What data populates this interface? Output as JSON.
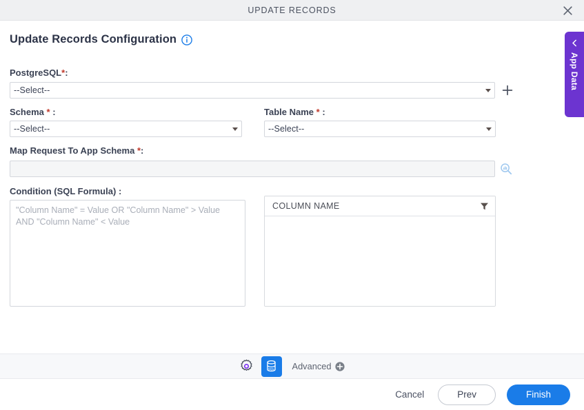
{
  "window": {
    "title": "UPDATE RECORDS",
    "close_icon": "close-icon"
  },
  "page": {
    "heading": "Update Records Configuration",
    "info_icon": "info-circle-icon"
  },
  "form": {
    "postgresql": {
      "label": "PostgreSQL",
      "required_mark": "*",
      "colon": ":",
      "value": "--Select--",
      "add_icon": "plus-icon"
    },
    "schema": {
      "label": "Schema",
      "required_mark": "*",
      "colon": ":",
      "value": "--Select--"
    },
    "table_name": {
      "label": "Table Name",
      "required_mark": "*",
      "colon": ":",
      "value": "--Select--"
    },
    "map_request": {
      "label": "Map Request To App Schema",
      "required_mark": "*",
      "colon": ":",
      "value": "",
      "placeholder": "",
      "search_icon": "data-search-icon"
    },
    "condition": {
      "label": "Condition (SQL Formula)",
      "colon": ":",
      "value": "",
      "placeholder": "\"Column Name\" = Value OR \"Column Name\" > Value AND \"Column Name\" < Value"
    },
    "column_panel": {
      "header": "COLUMN NAME",
      "filter_icon": "filter-funnel-icon",
      "rows": []
    }
  },
  "toolbar": {
    "settings_icon": "gear-icon",
    "database_icon": "database-icon",
    "advanced_label": "Advanced",
    "advanced_add_icon": "plus-circle-icon"
  },
  "footer": {
    "cancel_label": "Cancel",
    "prev_label": "Prev",
    "finish_label": "Finish"
  },
  "side_tab": {
    "label": "App Data",
    "chevron_icon": "chevron-left-icon"
  },
  "colors": {
    "accent_blue": "#1a7ce8",
    "purple": "#6c34d0",
    "required_red": "#c0392b",
    "header_bg": "#eff0f2",
    "toolbar_bg": "#f7f8fa"
  }
}
